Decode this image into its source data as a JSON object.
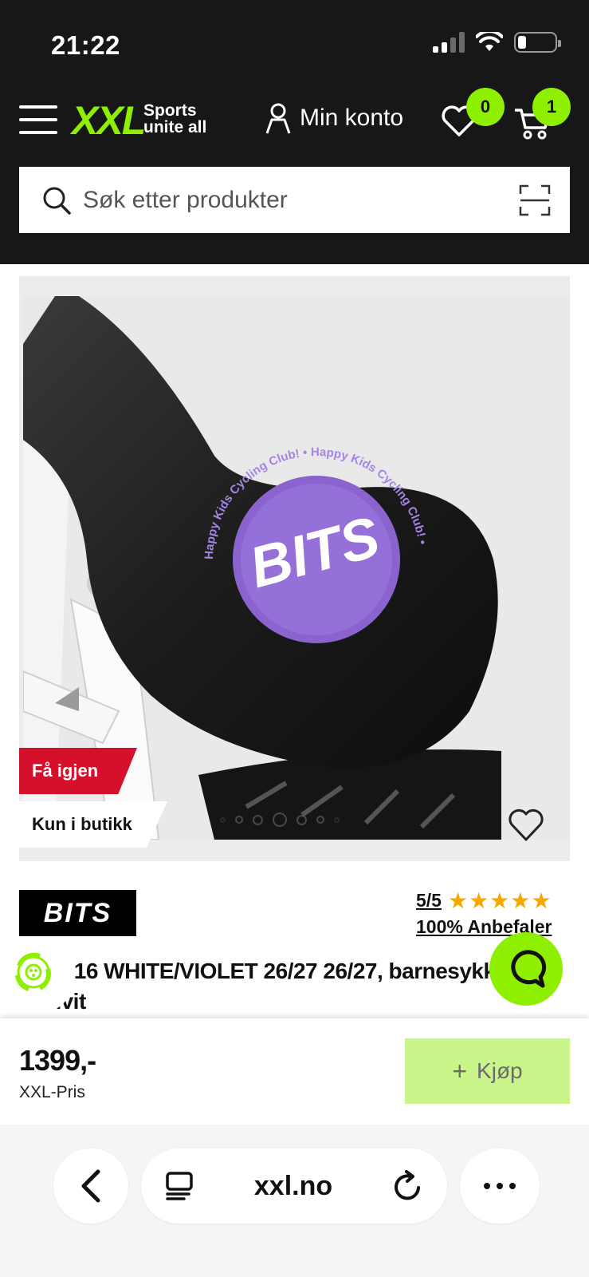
{
  "status_bar": {
    "time": "21:22"
  },
  "header": {
    "logo_text": "XXL",
    "logo_tagline_line1": "Sports",
    "logo_tagline_line2": "unite all",
    "account_label": "Min konto",
    "wishlist_count": "0",
    "cart_count": "1",
    "accent_color": "#8ef000"
  },
  "search": {
    "placeholder": "Søk etter produkter"
  },
  "gallery": {
    "tag_primary": "Få igjen",
    "tag_secondary": "Kun i butikk",
    "current_slide": 4,
    "slide_count": 7,
    "print_logo": "BITS",
    "print_ring": "Happy Kids Cycling Club! • Happy Kids Cycling Club! •"
  },
  "product": {
    "brand": "BITS",
    "rating": "5/5",
    "stars": "★★★★★",
    "recommend": "100% Anbefaler",
    "title": "er 16 WHITE/VIOLET 26/27 26/27, barnesykkel, hvit"
  },
  "pricebar": {
    "price": "1399,-",
    "price_label": "XXL-Pris",
    "buy_label": "Kjøp",
    "buy_plus": "+"
  },
  "browser": {
    "url": "xxl.no"
  }
}
